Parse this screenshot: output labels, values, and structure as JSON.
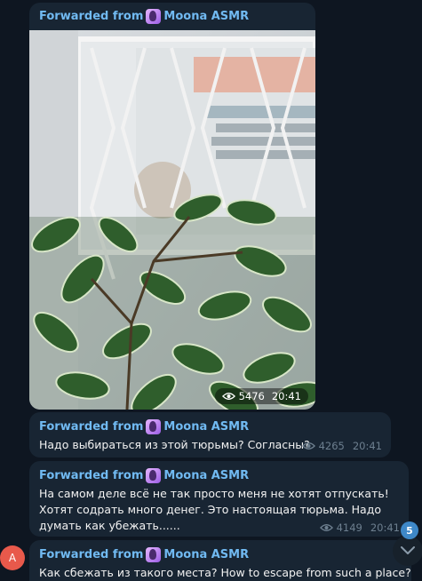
{
  "messages": [
    {
      "forwarded_label": "Forwarded from",
      "source": "Moona ASMR",
      "views": "5476",
      "time": "20:41"
    },
    {
      "forwarded_label": "Forwarded from",
      "source": "Moona ASMR",
      "text": "Надо выбираться из этой тюрьмы? Согласны?",
      "views": "4265",
      "time": "20:41"
    },
    {
      "forwarded_label": "Forwarded from",
      "source": "Moona ASMR",
      "text": "На самом деле всё не так просто меня не хотят отпускать! Хотят содрать много денег. Это настоящая тюрьма. Надо думать как убежать......",
      "views": "4149",
      "time": "20:41"
    },
    {
      "forwarded_label": "Forwarded from",
      "source": "Moona ASMR",
      "text": "Как сбежать из такого места? How to escape from such a place?"
    }
  ],
  "sender_avatar_initial": "A",
  "unread_count": "5",
  "colors": {
    "background": "#0e1621",
    "bubble": "#182533",
    "forward_name": "#71baf2",
    "meta": "#6d7f8f",
    "badge": "#3e88c8",
    "avatar": "#e8594b"
  },
  "icons": [
    "eye-icon",
    "chevron-down-icon"
  ]
}
